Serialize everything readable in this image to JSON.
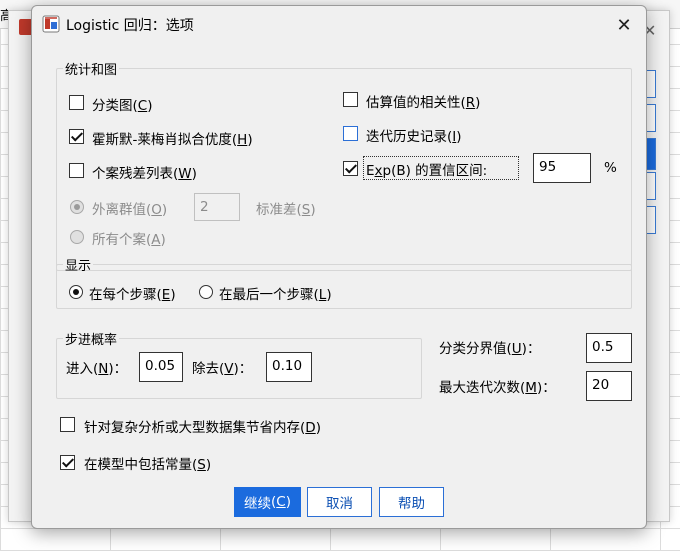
{
  "background": {
    "title_fragment": "高"
  },
  "dialog": {
    "title": "Logistic 回归：选项",
    "close_glyph": "✕"
  },
  "stats_group": {
    "legend": "统计和图",
    "classification_plot": {
      "label": "分类图",
      "key": "C",
      "checked": false
    },
    "hosmer": {
      "label": "霍斯默-莱梅肖拟合优度",
      "key": "H",
      "checked": true
    },
    "casewise": {
      "label": "个案残差列表",
      "key": "W",
      "checked": false
    },
    "outliers": {
      "label": "外离群值",
      "key": "O",
      "value": "2",
      "suffix": "标准差",
      "suffix_key": "S"
    },
    "all_cases": {
      "label": "所有个案",
      "key": "A"
    },
    "correlations": {
      "label": "估算值的相关性",
      "key": "R",
      "checked": false
    },
    "iteration_history": {
      "label": "迭代历史记录",
      "key": "I",
      "checked": false
    },
    "ci_exp": {
      "label_pre": "E",
      "label_key": "x",
      "label_post": "p(B) 的置信区间:",
      "checked": true,
      "value": "95",
      "unit": "%"
    }
  },
  "display_group": {
    "legend": "显示",
    "each_step": {
      "label": "在每个步骤",
      "key": "E",
      "selected": true
    },
    "last_step": {
      "label": "在最后一个步骤",
      "key": "L",
      "selected": false
    }
  },
  "stepwise_group": {
    "legend": "步进概率",
    "entry": {
      "label": "进入",
      "key": "N",
      "value": "0.05"
    },
    "removal": {
      "label": "除去",
      "key": "V",
      "value": "0.10"
    }
  },
  "classification_cutoff": {
    "label": "分类分界值",
    "key": "U",
    "value": "0.5"
  },
  "max_iterations": {
    "label": "最大迭代次数",
    "key": "M",
    "value": "20"
  },
  "conserve_memory": {
    "label": "针对复杂分析或大型数据集节省内存",
    "key": "D",
    "checked": false
  },
  "include_constant": {
    "label": "在模型中包括常量",
    "key": "S",
    "checked": true
  },
  "buttons": {
    "continue": {
      "label": "继续",
      "key": "C"
    },
    "cancel": {
      "label": "取消"
    },
    "help": {
      "label": "帮助"
    }
  },
  "colors": {
    "accent": "#1b6bde",
    "dialog_bg": "#f0f0f0"
  }
}
